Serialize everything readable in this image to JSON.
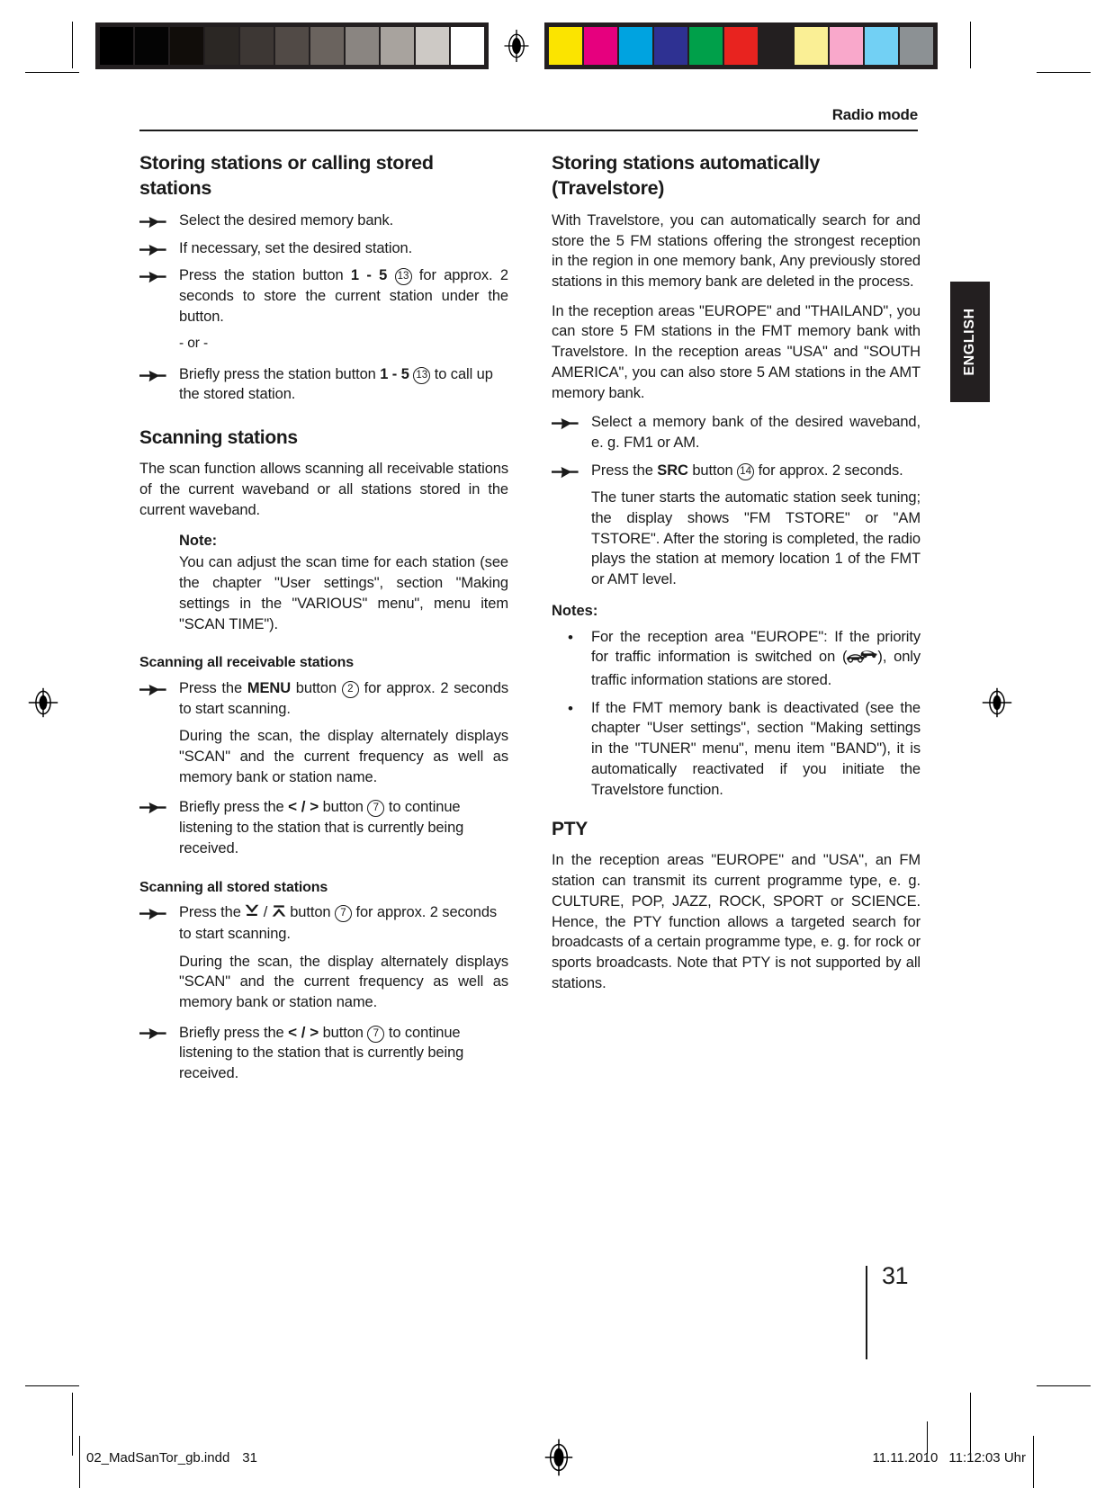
{
  "calibration": {
    "grayscale_swatches": [
      "#000000",
      "#040404",
      "#110d0a",
      "#2b2724",
      "#3d3734",
      "#514a46",
      "#6a635e",
      "#8a8581",
      "#a8a39e",
      "#cdc9c5",
      "#ffffff"
    ],
    "color_swatches": [
      "#fbe400",
      "#e6007e",
      "#00a3e0",
      "#2e3192",
      "#00a04a",
      "#e8231f",
      "#231f20",
      "#faef95",
      "#f9a8cb",
      "#72d0f4",
      "#8c9194"
    ],
    "registration_icon": "registration-mark-icon"
  },
  "header": {
    "title": "Radio mode"
  },
  "language_tab": {
    "label": "ENGLISH"
  },
  "left_column": {
    "heading": "Storing stations or calling stored stations",
    "steps": [
      {
        "icon": "hand-pointer-icon",
        "text": "Select the desired memory bank."
      },
      {
        "icon": "hand-pointer-icon",
        "text": "If necessary, set the desired station."
      }
    ],
    "step_press_station": {
      "icon": "hand-pointer-icon",
      "prefix": "Press the station button ",
      "button_label": "1 - 5",
      "ref": "13",
      "suffix": " for approx. 2 seconds to store the current station under the button."
    },
    "or_separator": "- or -",
    "step_briefly_press_station": {
      "icon": "hand-pointer-icon",
      "prefix": "Briefly press the station button ",
      "button_label": "1 - 5",
      "ref": "13",
      "suffix": " to call up the stored station."
    },
    "scanning_heading": "Scanning stations",
    "scanning_intro": "The scan function allows scanning all receivable stations of the current waveband or all stations stored in the current waveband.",
    "note": {
      "title": "Note:",
      "body": "You can adjust the scan time for each station (see the chapter \"User settings\", section \"Making settings in the \"VARIOUS\" menu\", menu item \"SCAN TIME\")."
    },
    "receivable_heading": "Scanning all receivable stations",
    "receivable_step": {
      "icon": "hand-pointer-icon",
      "prefix": "Press the ",
      "button_label": "MENU",
      "mid": " button ",
      "ref": "2",
      "suffix": " for approx. 2 seconds to start scanning."
    },
    "receivable_detail": "During the scan, the display alternately displays \"SCAN\" and the current frequency as well as memory bank or station name.",
    "receivable_continue": {
      "icon": "hand-pointer-icon",
      "prefix": "Briefly press the ",
      "glyph": "< / >",
      "mid": " button ",
      "ref": "7",
      "suffix": " to continue listening to the station that is currently being received."
    },
    "stored_heading": "Scanning all stored stations",
    "stored_step": {
      "icon": "hand-pointer-icon",
      "prefix": "Press the ",
      "glyph_down": "down-arrow-bar-icon",
      "glyph_sep": " / ",
      "glyph_up": "up-arrow-bar-icon",
      "mid": " button ",
      "ref": "7",
      "suffix": " for approx. 2 seconds to start scanning."
    },
    "stored_detail": "During the scan, the display alternately displays \"SCAN\" and the current frequency as well as memory bank or station name.",
    "stored_continue": {
      "icon": "hand-pointer-icon",
      "prefix": "Briefly press the ",
      "glyph": "< / >",
      "mid": " button ",
      "ref": "7",
      "suffix": " to continue listening to the station that is currently being received."
    }
  },
  "right_column": {
    "heading": "Storing stations automatically (Travelstore)",
    "para1": "With Travelstore, you can automatically search for and store the 5 FM stations offering the strongest reception in the region in one memory bank, Any previously stored stations in this memory bank are deleted in the process.",
    "para2": "In the reception areas \"EUROPE\" and \"THAILAND\", you can store 5 FM stations in the FMT memory bank with Travelstore. In the reception areas \"USA\" and \"SOUTH AMERICA\", you can also store 5 AM stations in the AMT memory bank.",
    "step_select_bank": {
      "icon": "hand-pointer-icon",
      "text": "Select a memory bank of the desired waveband, e. g. FM1 or AM."
    },
    "step_press_src": {
      "icon": "hand-pointer-icon",
      "prefix": "Press the ",
      "button_label": "SRC",
      "mid": " button ",
      "ref": "14",
      "suffix": " for approx. 2 seconds."
    },
    "src_detail": "The tuner starts the automatic station seek tuning; the display shows \"FM TSTORE\" or \"AM TSTORE\". After the storing is completed, the radio plays the station at memory location 1 of the FMT or AMT level.",
    "notes": {
      "title": "Notes:",
      "items": [
        {
          "bullet": "•",
          "prefix": "For the reception area \"EUROPE\": If the priority for traffic information is switched on (",
          "icon": "traffic-jam-cars-icon",
          "suffix": "), only traffic information stations are stored."
        },
        {
          "bullet": "•",
          "text": "If the FMT memory bank is deactivated (see the chapter \"User settings\", section \"Making settings in the \"TUNER\" menu\", menu item \"BAND\"), it is automatically reactivated if you initiate the Travelstore function."
        }
      ]
    },
    "pty_heading": "PTY",
    "pty_body": "In the reception areas \"EUROPE\" and \"USA\", an FM station can transmit its current programme type, e. g. CULTURE, POP, JAZZ, ROCK, SPORT or SCIENCE. Hence, the PTY function allows a targeted search for broadcasts of a certain programme type, e. g. for rock or sports broadcasts. Note that PTY is not supported by all stations."
  },
  "page_number": "31",
  "imposition_footer": {
    "filename": "02_MadSanTor_gb.indd",
    "page": "31",
    "registration_icon": "registration-mark-icon",
    "date": "11.11.2010",
    "time": "11:12:03 Uhr"
  }
}
